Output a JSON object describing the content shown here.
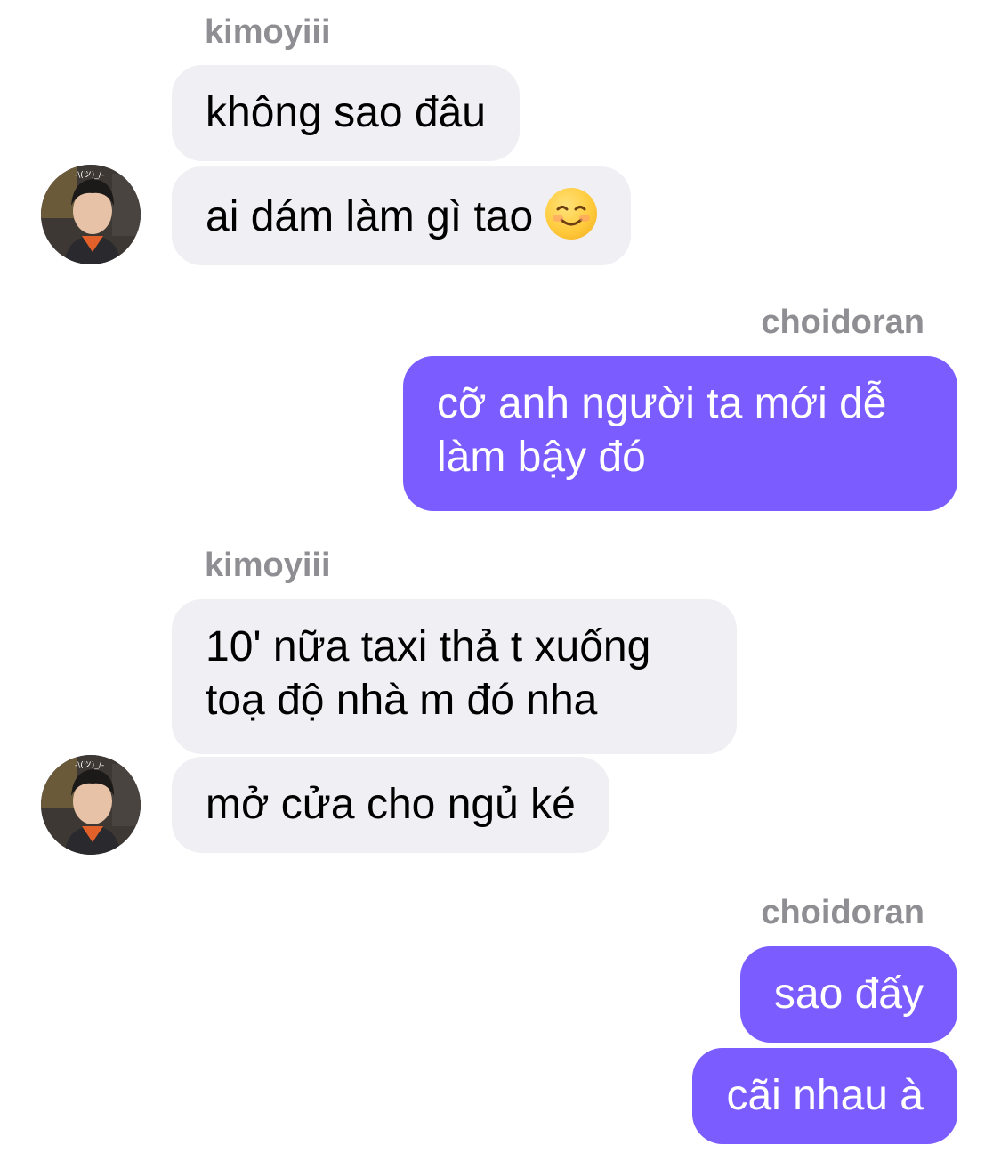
{
  "conversation": [
    {
      "type": "sender",
      "side": "left",
      "name": "kimoyiii"
    },
    {
      "type": "message",
      "side": "left",
      "lines": [
        "không sao đâu"
      ]
    },
    {
      "type": "message",
      "side": "left",
      "lines": [
        "ai dám làm gì tao"
      ],
      "emoji": "smiling-face-emoji"
    },
    {
      "type": "sender",
      "side": "right",
      "name": "choidoran"
    },
    {
      "type": "message",
      "side": "right",
      "lines": [
        "cỡ anh người ta mới dễ",
        "làm bậy đó"
      ]
    },
    {
      "type": "sender",
      "side": "left",
      "name": "kimoyiii"
    },
    {
      "type": "message",
      "side": "left",
      "lines": [
        "10' nữa taxi thả t xuống",
        "toạ độ nhà m đó nha"
      ]
    },
    {
      "type": "message",
      "side": "left",
      "lines": [
        "mở cửa cho ngủ ké"
      ]
    },
    {
      "type": "sender",
      "side": "right",
      "name": "choidoran"
    },
    {
      "type": "message",
      "side": "right",
      "lines": [
        "sao đấy"
      ]
    },
    {
      "type": "message",
      "side": "right",
      "lines": [
        "cãi nhau à"
      ]
    }
  ],
  "colors": {
    "outgoing_bubble": "#7b5cff",
    "incoming_bubble": "#efeff4",
    "sender_name": "#8e8e93"
  }
}
